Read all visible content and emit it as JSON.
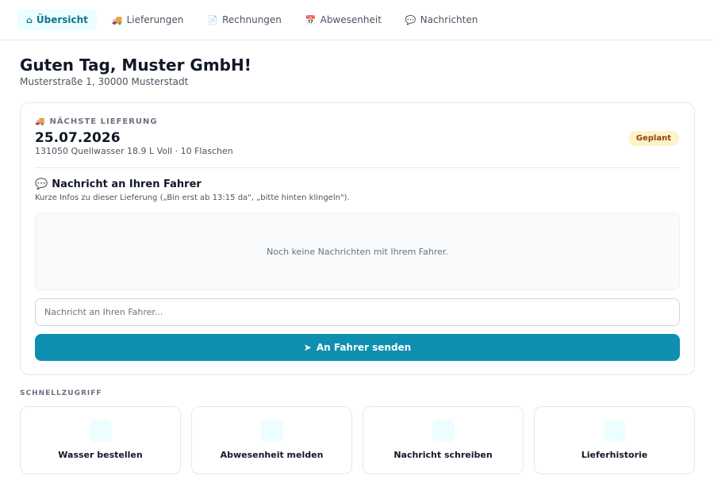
{
  "nav": {
    "tabs": [
      {
        "icon": "⌂",
        "label": "Übersicht",
        "active": true
      },
      {
        "icon": "🚚",
        "label": "Lieferungen"
      },
      {
        "icon": "📄",
        "label": "Rechnungen"
      },
      {
        "icon": "📅",
        "label": "Abwesenheit"
      },
      {
        "icon": "💬",
        "label": "Nachrichten"
      }
    ]
  },
  "header": {
    "title": "Guten Tag, Muster GmbH!",
    "address": "Musterstraße 1, 30000 Musterstadt"
  },
  "next_delivery": {
    "eyebrow_icon": "🚚",
    "eyebrow": "NÄCHSTE LIEFERUNG",
    "date": "25.07.2026",
    "product": "131050 Quellwasser 18.9 L Voll · 10 Flaschen",
    "status": "Geplant",
    "status_color": "#fef3c7"
  },
  "driver_message": {
    "title_icon": "💬",
    "title": "Nachricht an Ihren Fahrer",
    "hint": "Kurze Infos zu dieser Lieferung („Bin erst ab 13:15 da\", „bitte hinten klingeln\").",
    "empty_text": "Noch keine Nachrichten mit Ihrem Fahrer.",
    "input_value": "",
    "input_placeholder": "Nachricht an Ihren Fahrer...",
    "send_icon": "➤",
    "send_label": "An Fahrer senden",
    "accent_color": "#0e8fb0"
  },
  "quick_access": {
    "label": "SCHNELLZUGRIFF",
    "items": [
      {
        "label": "Wasser bestellen"
      },
      {
        "label": "Abwesenheit melden"
      },
      {
        "label": "Nachricht schreiben"
      },
      {
        "label": "Lieferhistorie"
      }
    ]
  }
}
